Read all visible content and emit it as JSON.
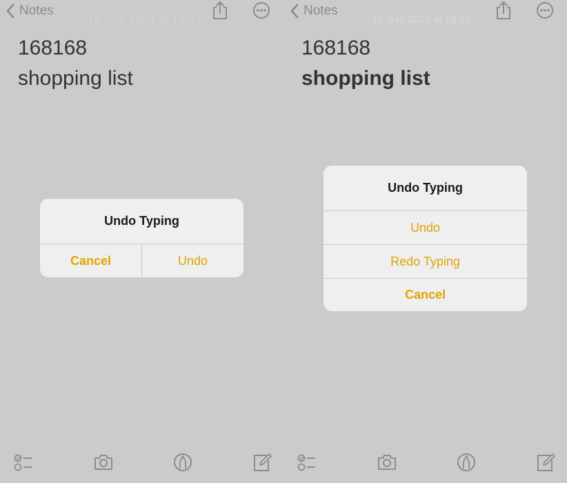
{
  "left": {
    "nav": {
      "back_label": "Notes",
      "timestamp": "10 July 2023 at 18:23"
    },
    "note": {
      "line1": "168168",
      "line2": "shopping list"
    },
    "alert": {
      "title": "Undo Typing",
      "cancel_label": "Cancel",
      "undo_label": "Undo"
    }
  },
  "right": {
    "nav": {
      "back_label": "Notes",
      "timestamp": "10 July 2023 at 18:23"
    },
    "note": {
      "line1": "168168",
      "line2": "shopping list"
    },
    "alert": {
      "title": "Undo Typing",
      "undo_label": "Undo",
      "redo_label": "Redo Typing",
      "cancel_label": "Cancel"
    }
  },
  "icons": {
    "back": "chevron-left-icon",
    "share": "share-icon",
    "more": "more-circle-icon",
    "checklist": "checklist-icon",
    "camera": "camera-icon",
    "markup": "pen-circle-icon",
    "compose": "compose-icon"
  },
  "colors": {
    "background": "#cbcbcb",
    "accent": "#e0a400",
    "alert_bg": "#efefef",
    "icon_gray": "#8c8c8c"
  }
}
